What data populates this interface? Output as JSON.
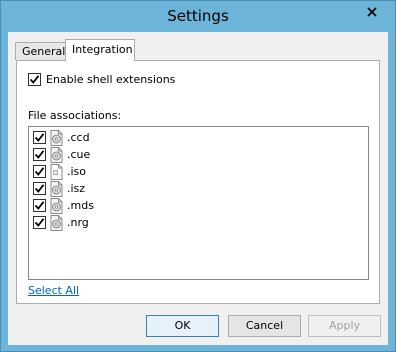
{
  "window": {
    "title": "Settings"
  },
  "tabs": [
    {
      "label": "General",
      "active": false
    },
    {
      "label": "Integration",
      "active": true
    }
  ],
  "integration": {
    "shell_extensions_label": "Enable shell extensions",
    "shell_extensions_checked": true,
    "file_associations_label": "File associations:",
    "file_types": [
      {
        "ext": ".ccd",
        "checked": true,
        "icon": "disc-image-icon"
      },
      {
        "ext": ".cue",
        "checked": true,
        "icon": "disc-image-icon"
      },
      {
        "ext": ".iso",
        "checked": true,
        "icon": "document-icon"
      },
      {
        "ext": ".isz",
        "checked": true,
        "icon": "disc-image-icon"
      },
      {
        "ext": ".mds",
        "checked": true,
        "icon": "disc-image-icon"
      },
      {
        "ext": ".nrg",
        "checked": true,
        "icon": "disc-image-icon"
      }
    ],
    "select_all_label": "Select All"
  },
  "buttons": {
    "ok_label": "OK",
    "cancel_label": "Cancel",
    "apply_label": "Apply",
    "apply_enabled": false
  },
  "colors": {
    "frame": "#6cb5d9",
    "link": "#0066cc",
    "ok_border": "#3c7fb1"
  }
}
